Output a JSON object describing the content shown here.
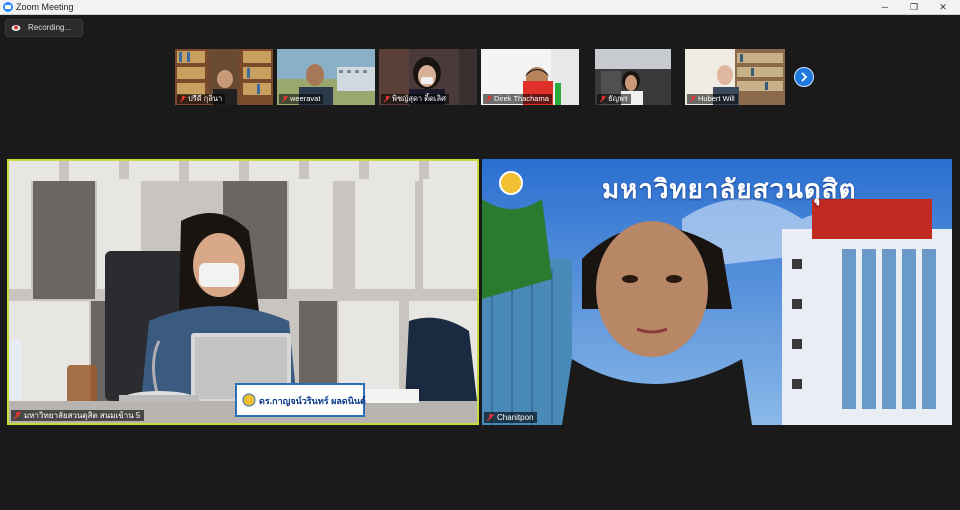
{
  "window": {
    "title": "Zoom Meeting",
    "minimize": "─",
    "restore": "❐",
    "close": "✕"
  },
  "recording": {
    "label": "Recording..."
  },
  "gallery": {
    "participants": [
      {
        "name": "ปรีดี กุลินา",
        "muted": true
      },
      {
        "name": "weeravat",
        "muted": true
      },
      {
        "name": "พิชญ์สุดา ติ้ดเลิศ",
        "muted": true
      },
      {
        "name": "Direk Thachama",
        "muted": true
      },
      {
        "name": "ธัญพร",
        "muted": true
      },
      {
        "name": "Hubert Will",
        "muted": true
      }
    ],
    "next_icon": "chevron-right-icon"
  },
  "main": {
    "left": {
      "name": "มหาวิทยาลัยสวนดุสิต สนมเข้าน 5",
      "nameplate": "ดร.กาญจน์วรินทร์ ผลดนินต์",
      "muted": true
    },
    "right": {
      "name": "Chanitpon",
      "banner": "มหาวิทยาลัยสวนดุสิต",
      "muted": true
    }
  },
  "colors": {
    "active_speaker": "#c7dc3c",
    "next_button": "#1f7ae0"
  }
}
